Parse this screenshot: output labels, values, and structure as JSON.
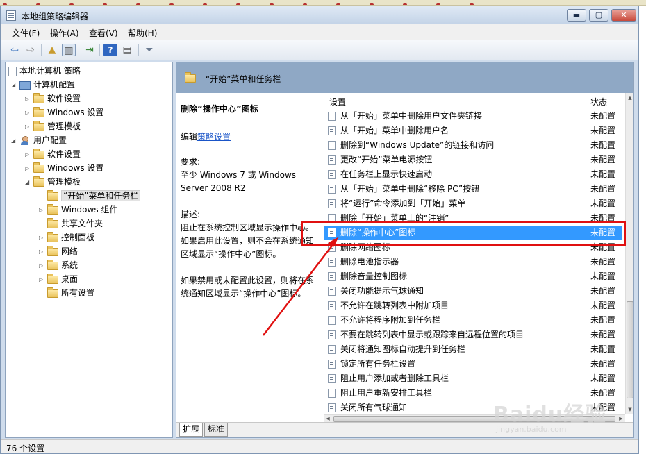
{
  "window": {
    "title": "本地组策略编辑器",
    "btn_min": "▬",
    "btn_max": "▢",
    "btn_close": "✕"
  },
  "menu": [
    "文件(F)",
    "操作(A)",
    "查看(V)",
    "帮助(H)"
  ],
  "toolbar_icons": [
    "back-icon",
    "forward-icon",
    "up-folder-icon",
    "show-hide-tree-icon",
    "export-list-icon",
    "help-icon",
    "properties-icon",
    "filter-icon"
  ],
  "tree": {
    "root": "本地计算机 策略",
    "computer_config": "计算机配置",
    "cc_software": "软件设置",
    "cc_windows": "Windows 设置",
    "cc_admin": "管理模板",
    "user_config": "用户配置",
    "uc_software": "软件设置",
    "uc_windows": "Windows 设置",
    "uc_admin": "管理模板",
    "start_taskbar": "“开始”菜单和任务栏",
    "win_components": "Windows 组件",
    "shared_folders": "共享文件夹",
    "control_panel": "控制面板",
    "network": "网络",
    "system": "系统",
    "desktop": "桌面",
    "all_settings": "所有设置"
  },
  "header": {
    "title": "“开始”菜单和任务栏"
  },
  "description": {
    "title": "删除“操作中心”图标",
    "edit_prefix": "编辑",
    "edit_link": "策略设置",
    "req_label": "要求:",
    "req_text": "至少 Windows 7 或 Windows Server 2008 R2",
    "desc_label": "描述:",
    "desc_text1": " 阻止在系统控制区域显示操作中心。如果启用此设置，则不会在系统通知区域显示“操作中心”图标。",
    "desc_text2": "如果禁用或未配置此设置，则将在系统通知区域显示“操作中心”图标。"
  },
  "list": {
    "col_setting": "设置",
    "col_state": "状态",
    "rows": [
      {
        "name": "从「开始」菜单中删除用户文件夹链接",
        "state": "未配置"
      },
      {
        "name": "从「开始」菜单中删除用户名",
        "state": "未配置"
      },
      {
        "name": "删除到“Windows Update”的链接和访问",
        "state": "未配置"
      },
      {
        "name": "更改“开始”菜单电源按钮",
        "state": "未配置"
      },
      {
        "name": "在任务栏上显示快速启动",
        "state": "未配置"
      },
      {
        "name": "从「开始」菜单中删除“移除 PC”按钮",
        "state": "未配置"
      },
      {
        "name": "将“运行”命令添加到「开始」菜单",
        "state": "未配置"
      },
      {
        "name": "删除「开始」菜单上的“注销”",
        "state": "未配置"
      },
      {
        "name": "删除“操作中心”图标",
        "state": "未配置"
      },
      {
        "name": "删除网络图标",
        "state": "未配置"
      },
      {
        "name": "删除电池指示器",
        "state": "未配置"
      },
      {
        "name": "删除音量控制图标",
        "state": "未配置"
      },
      {
        "name": "关闭功能提示气球通知",
        "state": "未配置"
      },
      {
        "name": "不允许在跳转列表中附加项目",
        "state": "未配置"
      },
      {
        "name": "不允许将程序附加到任务栏",
        "state": "未配置"
      },
      {
        "name": "不要在跳转列表中显示或跟踪来自远程位置的项目",
        "state": "未配置"
      },
      {
        "name": "关闭将通知图标自动提升到任务栏",
        "state": "未配置"
      },
      {
        "name": "锁定所有任务栏设置",
        "state": "未配置"
      },
      {
        "name": "阻止用户添加或者删除工具栏",
        "state": "未配置"
      },
      {
        "name": "阻止用户重新安排工具栏",
        "state": "未配置"
      },
      {
        "name": "关闭所有气球通知",
        "state": "未配置"
      }
    ],
    "selected_index": 8
  },
  "tabs": {
    "extended": "扩展",
    "standard": "标准"
  },
  "status": {
    "count": "76 个设置"
  },
  "watermark": {
    "main": "Baidu经验",
    "sub": "jingyan.baidu.com"
  },
  "colors": {
    "selection": "#3399ff",
    "annotation": "#e01010",
    "header": "#8fa8c5"
  }
}
